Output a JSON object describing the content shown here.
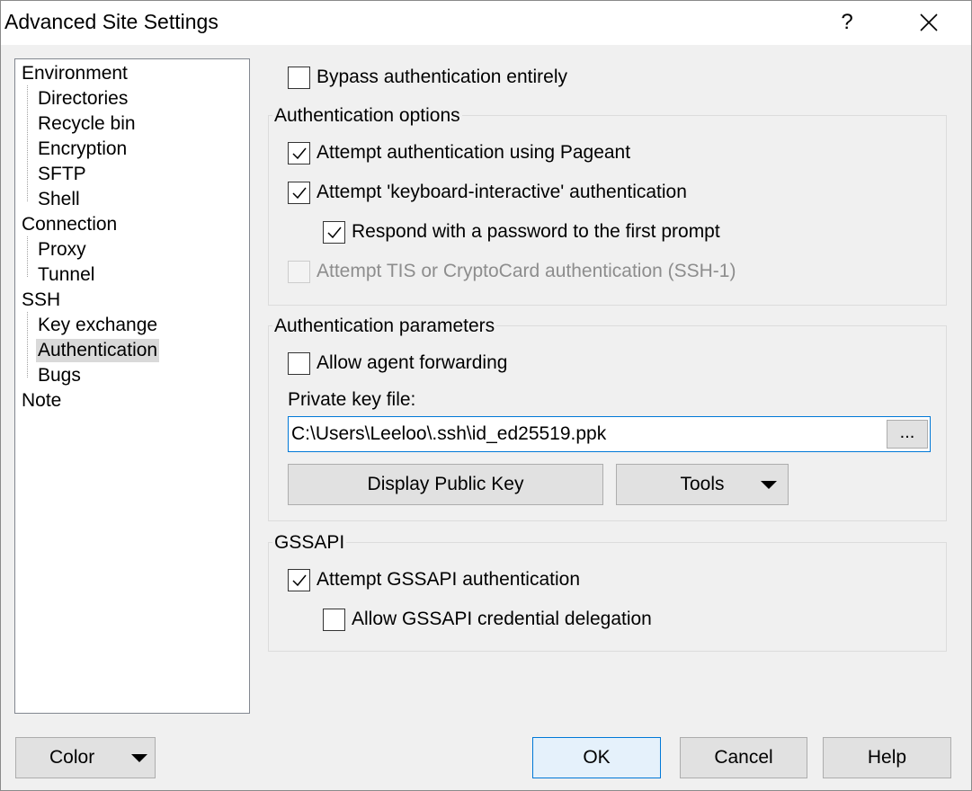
{
  "window": {
    "title": "Advanced Site Settings",
    "help_glyph": "?"
  },
  "tree": {
    "items": [
      {
        "label": "Environment",
        "level": 0
      },
      {
        "label": "Directories",
        "level": 1
      },
      {
        "label": "Recycle bin",
        "level": 1
      },
      {
        "label": "Encryption",
        "level": 1
      },
      {
        "label": "SFTP",
        "level": 1
      },
      {
        "label": "Shell",
        "level": 1
      },
      {
        "label": "Connection",
        "level": 0
      },
      {
        "label": "Proxy",
        "level": 1
      },
      {
        "label": "Tunnel",
        "level": 1
      },
      {
        "label": "SSH",
        "level": 0
      },
      {
        "label": "Key exchange",
        "level": 1
      },
      {
        "label": "Authentication",
        "level": 1,
        "selected": true
      },
      {
        "label": "Bugs",
        "level": 1
      },
      {
        "label": "Note",
        "level": 0
      }
    ]
  },
  "bypass": {
    "label": "Bypass authentication entirely",
    "checked": false
  },
  "auth_options": {
    "title": "Authentication options",
    "pageant": {
      "label": "Attempt authentication using Pageant",
      "checked": true
    },
    "keyboard_interactive": {
      "label": "Attempt 'keyboard-interactive' authentication",
      "checked": true
    },
    "respond_password": {
      "label": "Respond with a password to the first prompt",
      "checked": true
    },
    "tis": {
      "label": "Attempt TIS or CryptoCard authentication (SSH-1)",
      "checked": false,
      "disabled": true
    }
  },
  "auth_params": {
    "title": "Authentication parameters",
    "agent_forwarding": {
      "label": "Allow agent forwarding",
      "checked": false
    },
    "private_key_label": "Private key file:",
    "private_key_value": "C:\\Users\\Leeloo\\.ssh\\id_ed25519.ppk",
    "browse_label": "...",
    "display_public_key": "Display Public Key",
    "tools": "Tools"
  },
  "gssapi": {
    "title": "GSSAPI",
    "attempt": {
      "label": "Attempt GSSAPI authentication",
      "checked": true
    },
    "delegation": {
      "label": "Allow GSSAPI credential delegation",
      "checked": false
    }
  },
  "footer": {
    "color": "Color",
    "ok": "OK",
    "cancel": "Cancel",
    "help": "Help"
  },
  "colors": {
    "accent": "#0078d7",
    "selection": "#d9d9d9",
    "disabled_text": "#8d8d8d"
  }
}
